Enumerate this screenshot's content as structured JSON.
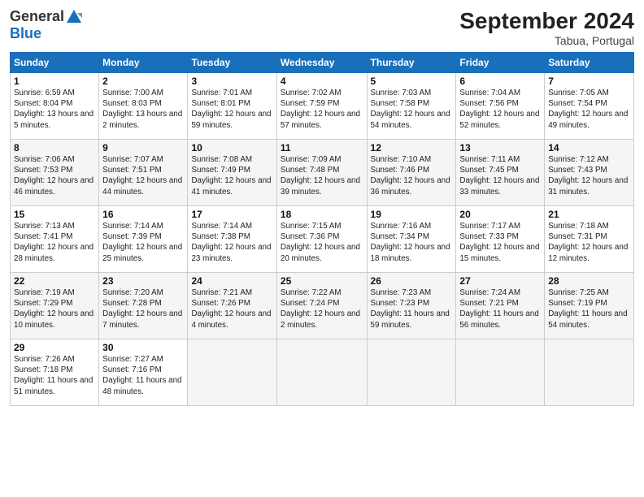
{
  "header": {
    "logo_line1": "General",
    "logo_line2": "Blue",
    "month": "September 2024",
    "location": "Tabua, Portugal"
  },
  "weekdays": [
    "Sunday",
    "Monday",
    "Tuesday",
    "Wednesday",
    "Thursday",
    "Friday",
    "Saturday"
  ],
  "weeks": [
    [
      {
        "day": "1",
        "sunrise": "Sunrise: 6:59 AM",
        "sunset": "Sunset: 8:04 PM",
        "daylight": "Daylight: 13 hours and 5 minutes."
      },
      {
        "day": "2",
        "sunrise": "Sunrise: 7:00 AM",
        "sunset": "Sunset: 8:03 PM",
        "daylight": "Daylight: 13 hours and 2 minutes."
      },
      {
        "day": "3",
        "sunrise": "Sunrise: 7:01 AM",
        "sunset": "Sunset: 8:01 PM",
        "daylight": "Daylight: 12 hours and 59 minutes."
      },
      {
        "day": "4",
        "sunrise": "Sunrise: 7:02 AM",
        "sunset": "Sunset: 7:59 PM",
        "daylight": "Daylight: 12 hours and 57 minutes."
      },
      {
        "day": "5",
        "sunrise": "Sunrise: 7:03 AM",
        "sunset": "Sunset: 7:58 PM",
        "daylight": "Daylight: 12 hours and 54 minutes."
      },
      {
        "day": "6",
        "sunrise": "Sunrise: 7:04 AM",
        "sunset": "Sunset: 7:56 PM",
        "daylight": "Daylight: 12 hours and 52 minutes."
      },
      {
        "day": "7",
        "sunrise": "Sunrise: 7:05 AM",
        "sunset": "Sunset: 7:54 PM",
        "daylight": "Daylight: 12 hours and 49 minutes."
      }
    ],
    [
      {
        "day": "8",
        "sunrise": "Sunrise: 7:06 AM",
        "sunset": "Sunset: 7:53 PM",
        "daylight": "Daylight: 12 hours and 46 minutes."
      },
      {
        "day": "9",
        "sunrise": "Sunrise: 7:07 AM",
        "sunset": "Sunset: 7:51 PM",
        "daylight": "Daylight: 12 hours and 44 minutes."
      },
      {
        "day": "10",
        "sunrise": "Sunrise: 7:08 AM",
        "sunset": "Sunset: 7:49 PM",
        "daylight": "Daylight: 12 hours and 41 minutes."
      },
      {
        "day": "11",
        "sunrise": "Sunrise: 7:09 AM",
        "sunset": "Sunset: 7:48 PM",
        "daylight": "Daylight: 12 hours and 39 minutes."
      },
      {
        "day": "12",
        "sunrise": "Sunrise: 7:10 AM",
        "sunset": "Sunset: 7:46 PM",
        "daylight": "Daylight: 12 hours and 36 minutes."
      },
      {
        "day": "13",
        "sunrise": "Sunrise: 7:11 AM",
        "sunset": "Sunset: 7:45 PM",
        "daylight": "Daylight: 12 hours and 33 minutes."
      },
      {
        "day": "14",
        "sunrise": "Sunrise: 7:12 AM",
        "sunset": "Sunset: 7:43 PM",
        "daylight": "Daylight: 12 hours and 31 minutes."
      }
    ],
    [
      {
        "day": "15",
        "sunrise": "Sunrise: 7:13 AM",
        "sunset": "Sunset: 7:41 PM",
        "daylight": "Daylight: 12 hours and 28 minutes."
      },
      {
        "day": "16",
        "sunrise": "Sunrise: 7:14 AM",
        "sunset": "Sunset: 7:39 PM",
        "daylight": "Daylight: 12 hours and 25 minutes."
      },
      {
        "day": "17",
        "sunrise": "Sunrise: 7:14 AM",
        "sunset": "Sunset: 7:38 PM",
        "daylight": "Daylight: 12 hours and 23 minutes."
      },
      {
        "day": "18",
        "sunrise": "Sunrise: 7:15 AM",
        "sunset": "Sunset: 7:36 PM",
        "daylight": "Daylight: 12 hours and 20 minutes."
      },
      {
        "day": "19",
        "sunrise": "Sunrise: 7:16 AM",
        "sunset": "Sunset: 7:34 PM",
        "daylight": "Daylight: 12 hours and 18 minutes."
      },
      {
        "day": "20",
        "sunrise": "Sunrise: 7:17 AM",
        "sunset": "Sunset: 7:33 PM",
        "daylight": "Daylight: 12 hours and 15 minutes."
      },
      {
        "day": "21",
        "sunrise": "Sunrise: 7:18 AM",
        "sunset": "Sunset: 7:31 PM",
        "daylight": "Daylight: 12 hours and 12 minutes."
      }
    ],
    [
      {
        "day": "22",
        "sunrise": "Sunrise: 7:19 AM",
        "sunset": "Sunset: 7:29 PM",
        "daylight": "Daylight: 12 hours and 10 minutes."
      },
      {
        "day": "23",
        "sunrise": "Sunrise: 7:20 AM",
        "sunset": "Sunset: 7:28 PM",
        "daylight": "Daylight: 12 hours and 7 minutes."
      },
      {
        "day": "24",
        "sunrise": "Sunrise: 7:21 AM",
        "sunset": "Sunset: 7:26 PM",
        "daylight": "Daylight: 12 hours and 4 minutes."
      },
      {
        "day": "25",
        "sunrise": "Sunrise: 7:22 AM",
        "sunset": "Sunset: 7:24 PM",
        "daylight": "Daylight: 12 hours and 2 minutes."
      },
      {
        "day": "26",
        "sunrise": "Sunrise: 7:23 AM",
        "sunset": "Sunset: 7:23 PM",
        "daylight": "Daylight: 11 hours and 59 minutes."
      },
      {
        "day": "27",
        "sunrise": "Sunrise: 7:24 AM",
        "sunset": "Sunset: 7:21 PM",
        "daylight": "Daylight: 11 hours and 56 minutes."
      },
      {
        "day": "28",
        "sunrise": "Sunrise: 7:25 AM",
        "sunset": "Sunset: 7:19 PM",
        "daylight": "Daylight: 11 hours and 54 minutes."
      }
    ],
    [
      {
        "day": "29",
        "sunrise": "Sunrise: 7:26 AM",
        "sunset": "Sunset: 7:18 PM",
        "daylight": "Daylight: 11 hours and 51 minutes."
      },
      {
        "day": "30",
        "sunrise": "Sunrise: 7:27 AM",
        "sunset": "Sunset: 7:16 PM",
        "daylight": "Daylight: 11 hours and 48 minutes."
      },
      null,
      null,
      null,
      null,
      null
    ]
  ]
}
